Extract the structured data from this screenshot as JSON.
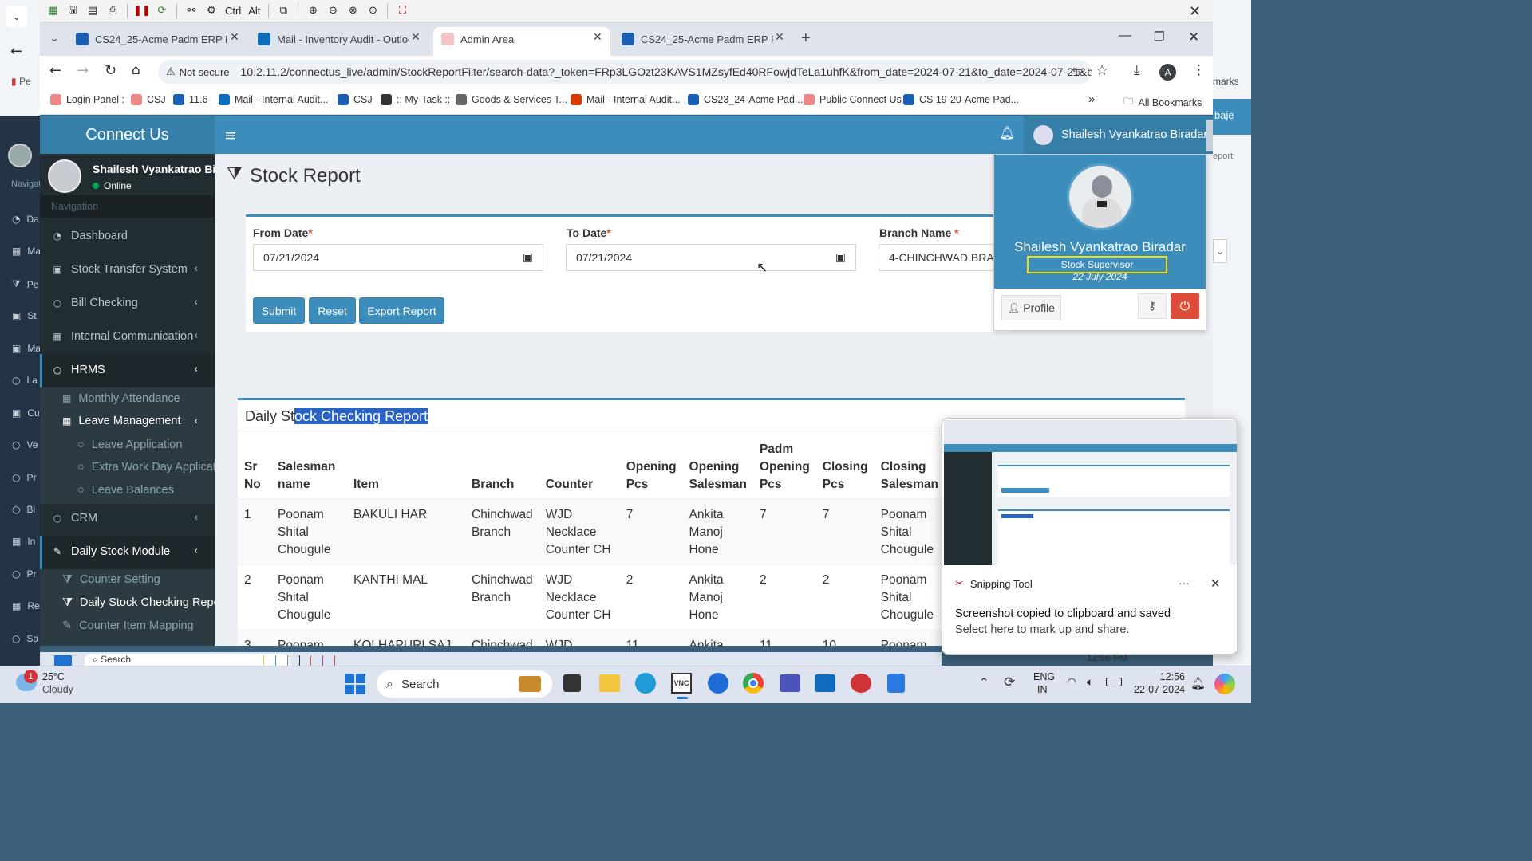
{
  "remote_toolbar": {
    "ctrl_label": "Ctrl",
    "alt_label": "Alt"
  },
  "browser": {
    "tabs": [
      {
        "title": "CS24_25-Acme Padm ERP Platf",
        "favicon_color": "#1a5fb4"
      },
      {
        "title": "Mail - Inventory Audit - Outloo",
        "favicon_color": "#0f6cbd"
      },
      {
        "title": "Admin Area",
        "favicon_color": "#f5c4c4"
      },
      {
        "title": "CS24_25-Acme Padm ERP Platf",
        "favicon_color": "#1a5fb4"
      }
    ],
    "not_secure": "Not secure",
    "url": "10.2.11.2/connectus_live/admin/StockReportFilter/search-data?_token=FRp3LGOzt23KAVS1MZsyfEd40RFowjdTeLa1uhfK&from_date=2024-07-21&to_date=2024-07-21&bran...",
    "profile_initial": "A",
    "bookmarks": [
      "Login Panel :",
      "CSJ",
      "11.6",
      "Mail - Internal Audit...",
      "CSJ",
      ":: My-Task ::",
      "Goods & Services T...",
      "Mail - Internal Audit...",
      "CS23_24-Acme Pad...",
      "Public Connect Us",
      "CS 19-20-Acme Pad..."
    ],
    "all_bookmarks": "All Bookmarks",
    "outer_right_texts": [
      "marks",
      "baje",
      "eport"
    ]
  },
  "outer_sidebar": {
    "nav_label": "Navigat",
    "items": [
      "Da",
      "Ma",
      "Pe",
      "St",
      "Ma",
      "La",
      "Cu",
      "Ve",
      "Pr",
      "Bi",
      "In",
      "Pr",
      "Re",
      "Sa"
    ],
    "outer_pe": "Pe"
  },
  "app": {
    "logo": "Connect Us",
    "header_user": "Shailesh Vyankatrao Biradar",
    "sidebar": {
      "user_name": "Shailesh Vyankatrao Biradar",
      "status": "Online",
      "nav_header": "Navigation",
      "items": {
        "dashboard": "Dashboard",
        "stock_transfer": "Stock Transfer System",
        "bill_checking": "Bill Checking",
        "internal_comm": "Internal Communication",
        "hrms": "HRMS",
        "monthly_attendance": "Monthly Attendance",
        "leave_management": "Leave Management",
        "leave_application": "Leave Application",
        "extra_work": "Extra Work Day Application",
        "leave_balances": "Leave Balances",
        "crm": "CRM",
        "daily_stock": "Daily Stock Module",
        "counter_setting": "Counter Setting",
        "daily_stock_report": "Daily Stock Checking Report",
        "counter_item_mapping": "Counter Item Mapping"
      }
    },
    "page_title": "Stock Report",
    "filter": {
      "from_label": "From Date",
      "to_label": "To Date",
      "branch_label": "Branch Name",
      "req": "*",
      "from_value": "07/21/2024",
      "to_value": "07/21/2024",
      "branch_value": "4-CHINCHWAD BRANCH",
      "submit": "Submit",
      "reset": "Reset",
      "export": "Export Report"
    },
    "report": {
      "title_plain": "Daily St",
      "title_selected": "ock Checking Report",
      "columns": [
        [
          "Sr",
          "No"
        ],
        [
          "Salesman",
          "name"
        ],
        [
          "Item"
        ],
        [
          "Branch"
        ],
        [
          "Counter"
        ],
        [
          "Opening",
          "Pcs"
        ],
        [
          "Opening",
          "Salesman"
        ],
        [
          "Padm",
          "Opening",
          "Pcs"
        ],
        [
          "Closing",
          "Pcs"
        ],
        [
          "Closing",
          "Salesman"
        ]
      ],
      "rows": [
        {
          "sr": "1",
          "salesman": [
            "Poonam",
            "Shital",
            "Chougule"
          ],
          "item": "BAKULI HAR",
          "branch": [
            "Chinchwad",
            "Branch"
          ],
          "counter": [
            "WJD",
            "Necklace",
            "Counter CH"
          ],
          "open_pcs": "7",
          "open_sm": [
            "Ankita",
            "Manoj",
            "Hone"
          ],
          "padm": "7",
          "close_pcs": "7",
          "close_sm": [
            "Poonam",
            "Shital",
            "Chougule"
          ]
        },
        {
          "sr": "2",
          "salesman": [
            "Poonam",
            "Shital",
            "Chougule"
          ],
          "item": "KANTHI MAL",
          "branch": [
            "Chinchwad",
            "Branch"
          ],
          "counter": [
            "WJD",
            "Necklace",
            "Counter CH"
          ],
          "open_pcs": "2",
          "open_sm": [
            "Ankita",
            "Manoj",
            "Hone"
          ],
          "padm": "2",
          "close_pcs": "2",
          "close_sm": [
            "Poonam",
            "Shital",
            "Chougule"
          ]
        },
        {
          "sr": "3",
          "salesman": [
            "Poonam"
          ],
          "item": "KOLHAPURI SAJ",
          "branch": [
            "Chinchwad"
          ],
          "counter": [
            "WJD"
          ],
          "open_pcs": "11",
          "open_sm": [
            "Ankita"
          ],
          "padm": "11",
          "close_pcs": "10",
          "close_sm": [
            "Poonam"
          ]
        }
      ]
    },
    "user_dropdown": {
      "name": "Shailesh Vyankatrao Biradar",
      "role": "Stock Supervisor",
      "date": "22 July 2024",
      "profile_btn": "Profile"
    }
  },
  "snipping": {
    "app": "Snipping Tool",
    "more": "···",
    "title": "Screenshot copied to clipboard and saved",
    "subtitle": "Select here to mark up and share."
  },
  "taskbar": {
    "weather_temp": "25°C",
    "weather_cond": "Cloudy",
    "weather_badge": "1",
    "search": "Search",
    "lang1": "ENG",
    "lang2": "IN",
    "time": "12:56",
    "date": "22-07-2024",
    "remote_time": "12:56 PM",
    "remote_search": "Search"
  }
}
